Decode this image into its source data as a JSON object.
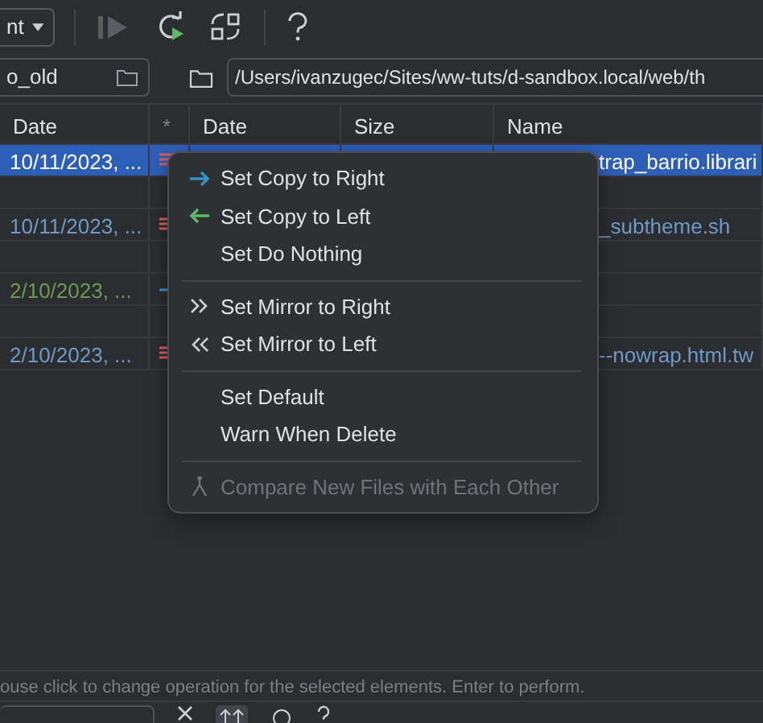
{
  "toolbar": {
    "dropdown": "nt",
    "buttons": [
      {
        "kind": "play",
        "disabled": true
      },
      {
        "kind": "refresh",
        "disabled": false
      },
      {
        "kind": "sync",
        "disabled": false
      },
      {
        "kind": "help",
        "disabled": false
      }
    ]
  },
  "paths": {
    "left": "o_old",
    "right": "/Users/ivanzugec/Sites/ww-tuts/d-sandbox.local/web/th"
  },
  "table": {
    "columns": [
      "Date",
      "*",
      "Date",
      "Size",
      "Name"
    ],
    "rows": [
      {
        "kind": "conflict",
        "date": "10/11/2023, ...",
        "name": "trap_barrio.librari",
        "selected": true
      },
      {
        "kind": "blank",
        "selected": false
      },
      {
        "kind": "conflict",
        "date": "10/11/2023, ...",
        "color": "#6e9ac8",
        "name": "_subtheme.sh",
        "selected": false
      },
      {
        "kind": "blank",
        "selected": false
      },
      {
        "kind": "copy",
        "date": "2/10/2023, ...",
        "color": "#6b9a4f",
        "selected": false
      },
      {
        "kind": "blank",
        "selected": false
      },
      {
        "kind": "conflict",
        "date": "2/10/2023, ...",
        "color": "#6e9ac8",
        "name": "--nowrap.html.tw",
        "selected": false
      }
    ]
  },
  "menu": {
    "groups": [
      [
        {
          "label": "Set Copy to Right",
          "kind": "right",
          "disabled": false
        },
        {
          "label": "Set Copy to Left",
          "kind": "left",
          "disabled": false
        },
        {
          "label": "Set Do Nothing",
          "kind": "plain",
          "disabled": false
        }
      ],
      [
        {
          "label": "Set Mirror to Right",
          "kind": "mirror_right",
          "disabled": false
        },
        {
          "label": "Set Mirror to Left",
          "kind": "mirror_left",
          "disabled": false
        }
      ],
      [
        {
          "label": "Set Default",
          "kind": "plain",
          "disabled": false
        },
        {
          "label": "Warn When Delete",
          "kind": "plain",
          "disabled": false
        }
      ],
      [
        {
          "label": "Compare New Files with Each Other",
          "kind": "compare",
          "disabled": true
        }
      ]
    ]
  },
  "status": "ouse click to change operation for the selected elements. Enter to perform."
}
